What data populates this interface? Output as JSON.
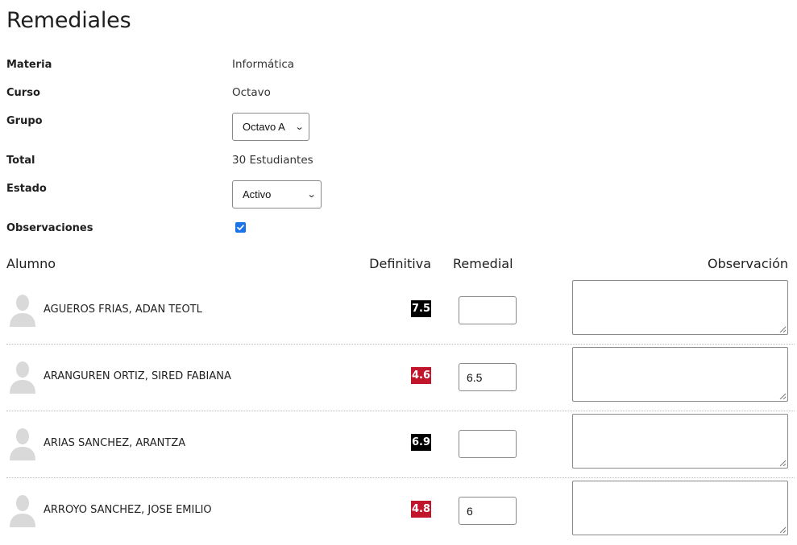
{
  "page": {
    "title": "Remediales"
  },
  "info": {
    "materia_label": "Materia",
    "materia_value": "Informática",
    "curso_label": "Curso",
    "curso_value": "Octavo",
    "grupo_label": "Grupo",
    "grupo_selected": "Octavo A",
    "total_label": "Total",
    "total_value": "30 Estudiantes",
    "estado_label": "Estado",
    "estado_selected": "Activo",
    "observaciones_label": "Observaciones",
    "observaciones_checked": true
  },
  "table": {
    "headers": {
      "alumno": "Alumno",
      "definitiva": "Definitiva",
      "remedial": "Remedial",
      "observacion": "Observación"
    },
    "rows": [
      {
        "name": "AGUEROS FRIAS, ADAN TEOTL",
        "definitiva": "7.5",
        "status": "pass",
        "remedial": "",
        "observacion": ""
      },
      {
        "name": "ARANGUREN ORTIZ, SIRED FABIANA",
        "definitiva": "4.6",
        "status": "fail",
        "remedial": "6.5",
        "observacion": ""
      },
      {
        "name": "ARIAS SANCHEZ, ARANTZA",
        "definitiva": "6.9",
        "status": "pass",
        "remedial": "",
        "observacion": ""
      },
      {
        "name": "ARROYO SANCHEZ, JOSE EMILIO",
        "definitiva": "4.8",
        "status": "fail",
        "remedial": "6",
        "observacion": ""
      }
    ]
  },
  "colors": {
    "pass_badge": "#000000",
    "fail_badge": "#c0152b",
    "checkbox": "#1a73e8",
    "avatar": "#d9d9d9"
  },
  "icons": {
    "avatar": "user-silhouette-icon",
    "select_arrow": "chevron-down-icon",
    "checkbox": "check-icon",
    "resize": "resize-grip-icon"
  }
}
